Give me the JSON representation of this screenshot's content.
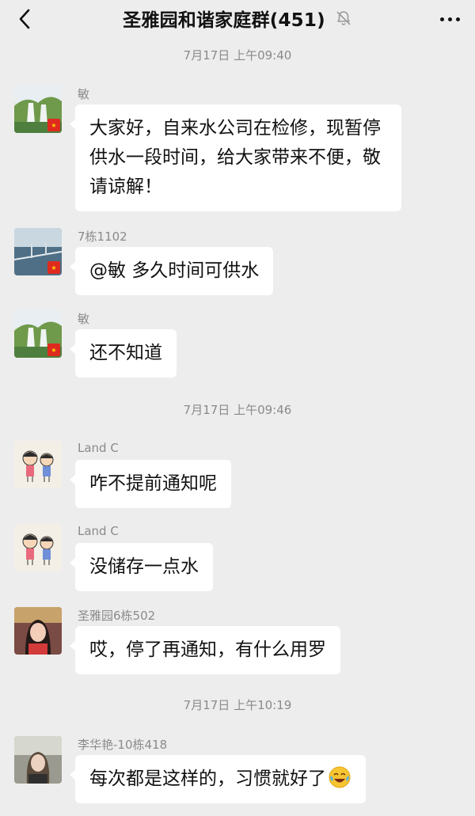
{
  "header": {
    "title": "圣雅园和谐家庭群(451)",
    "back_icon": "chevron-left-icon",
    "mute_icon": "bell-muted-icon",
    "more_icon": "more-dots-icon"
  },
  "timestamps": [
    "7月17日 上午09:40",
    "7月17日 上午09:46",
    "7月17日 上午10:19"
  ],
  "messages": [
    {
      "sender": "敏",
      "avatar": "waterfall-landscape-avatar",
      "text": "大家好，自来水公司在检修，现暂停供水一段时间，给大家带来不便，敬请谅解！"
    },
    {
      "sender": "7栋1102",
      "avatar": "sea-bridge-avatar",
      "text": "@敏  多久时间可供水"
    },
    {
      "sender": "敏",
      "avatar": "waterfall-landscape-avatar",
      "text": "还不知道"
    },
    {
      "sender": "Land C",
      "avatar": "cartoon-kids-avatar",
      "text": "咋不提前通知呢"
    },
    {
      "sender": "Land C",
      "avatar": "cartoon-kids-avatar",
      "text": "没储存一点水"
    },
    {
      "sender": "圣雅园6栋502",
      "avatar": "woman-photo-avatar",
      "text": "哎，停了再通知，有什么用罗"
    },
    {
      "sender": "李华艳-10栋418",
      "avatar": "woman-photo-avatar",
      "text": "每次都是这样的，习惯就好了",
      "emoji": "crying-laughing-emoji"
    }
  ]
}
